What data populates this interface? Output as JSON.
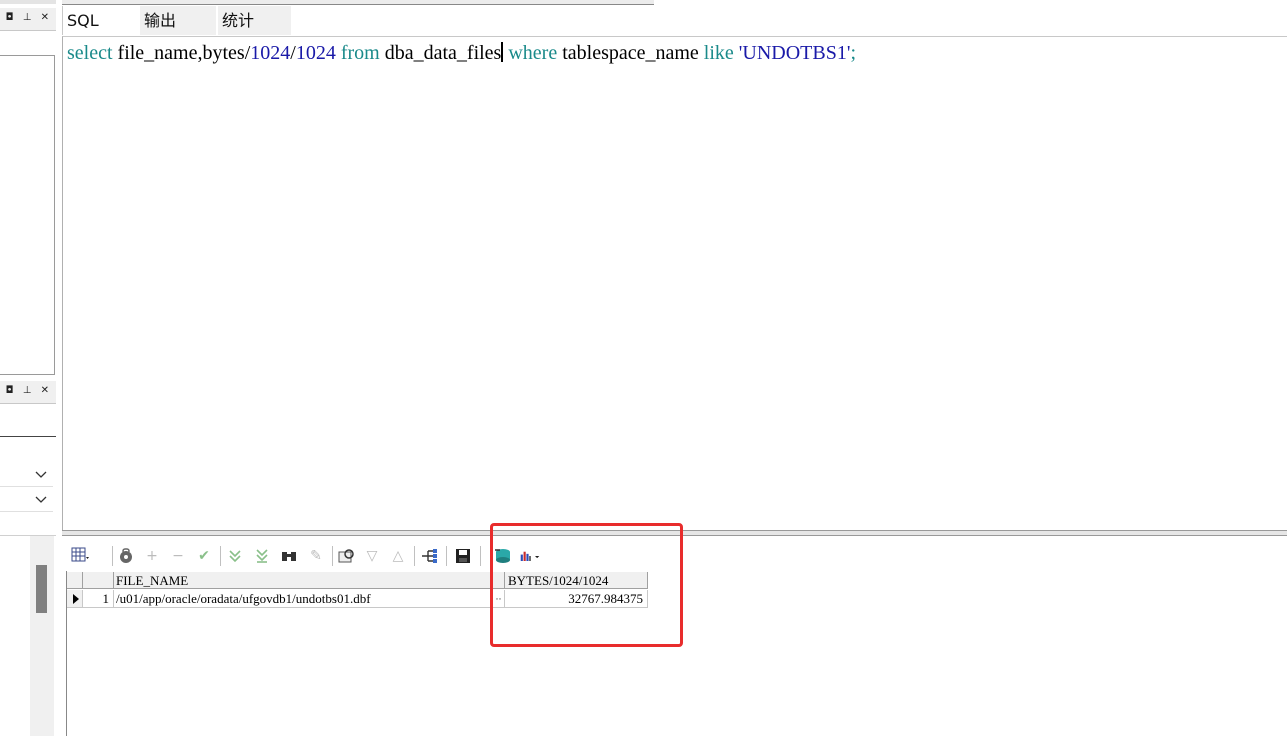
{
  "tabs": [
    {
      "label": "SQL"
    },
    {
      "label": "输出"
    },
    {
      "label": "统计"
    }
  ],
  "panel_buttons": "◘ ⊥ ✕",
  "editor": {
    "tokens": [
      {
        "t": "select",
        "c": "kw"
      },
      {
        "t": " file_name,bytes/",
        "c": ""
      },
      {
        "t": "1024",
        "c": "num"
      },
      {
        "t": "/",
        "c": ""
      },
      {
        "t": "1024",
        "c": "num"
      },
      {
        "t": " ",
        "c": ""
      },
      {
        "t": "from",
        "c": "kw"
      },
      {
        "t": " dba_data_files",
        "c": ""
      },
      {
        "t": "|caret|",
        "c": "caret"
      },
      {
        "t": " ",
        "c": ""
      },
      {
        "t": "where",
        "c": "kw"
      },
      {
        "t": " tablespace_name ",
        "c": ""
      },
      {
        "t": "like",
        "c": "kw"
      },
      {
        "t": " ",
        "c": ""
      },
      {
        "t": "'UNDOTBS1'",
        "c": "str"
      },
      {
        "t": ";",
        "c": "kw"
      }
    ]
  },
  "results": {
    "columns": [
      "FILE_NAME",
      "BYTES/1024/1024"
    ],
    "rows": [
      {
        "index": "1",
        "file_name": "/u01/app/oracle/oradata/ufgovdb1/undotbs01.dbf",
        "bytes": "32767.984375"
      }
    ]
  },
  "colors": {
    "keyword": "#1a8a8a",
    "number": "#1a1aa8",
    "highlight_box": "#e82c2c"
  }
}
